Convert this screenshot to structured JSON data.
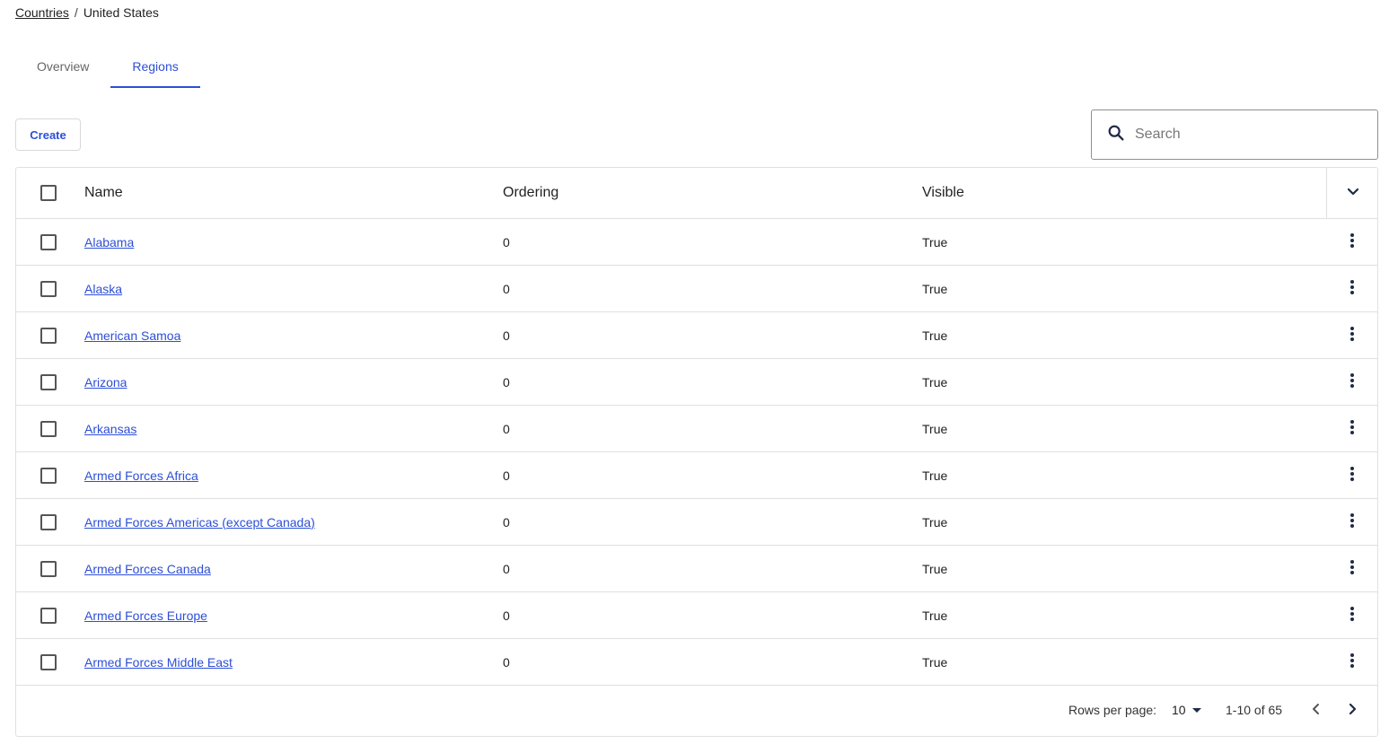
{
  "breadcrumb": {
    "parent": "Countries",
    "separator": "/",
    "current": "United States"
  },
  "tabs": [
    {
      "label": "Overview",
      "active": false
    },
    {
      "label": "Regions",
      "active": true
    }
  ],
  "toolbar": {
    "create_label": "Create",
    "search_placeholder": "Search"
  },
  "table": {
    "columns": {
      "name": "Name",
      "ordering": "Ordering",
      "visible": "Visible"
    },
    "rows": [
      {
        "name": "Alabama",
        "ordering": "0",
        "visible": "True"
      },
      {
        "name": "Alaska",
        "ordering": "0",
        "visible": "True"
      },
      {
        "name": "American Samoa",
        "ordering": "0",
        "visible": "True"
      },
      {
        "name": "Arizona",
        "ordering": "0",
        "visible": "True"
      },
      {
        "name": "Arkansas",
        "ordering": "0",
        "visible": "True"
      },
      {
        "name": "Armed Forces Africa",
        "ordering": "0",
        "visible": "True"
      },
      {
        "name": "Armed Forces Americas (except Canada)",
        "ordering": "0",
        "visible": "True"
      },
      {
        "name": "Armed Forces Canada",
        "ordering": "0",
        "visible": "True"
      },
      {
        "name": "Armed Forces Europe",
        "ordering": "0",
        "visible": "True"
      },
      {
        "name": "Armed Forces Middle East",
        "ordering": "0",
        "visible": "True"
      }
    ]
  },
  "pagination": {
    "rows_per_page_label": "Rows per page:",
    "rows_per_page": "10",
    "range": "1-10 of 65"
  },
  "colors": {
    "accent": "#2d4fd6",
    "border": "#e0e0e0",
    "text": "#222222"
  },
  "icons": [
    "search-icon",
    "chevron-down-icon",
    "more-vertical-icon",
    "caret-down-icon",
    "chevron-left-icon",
    "chevron-right-icon"
  ]
}
